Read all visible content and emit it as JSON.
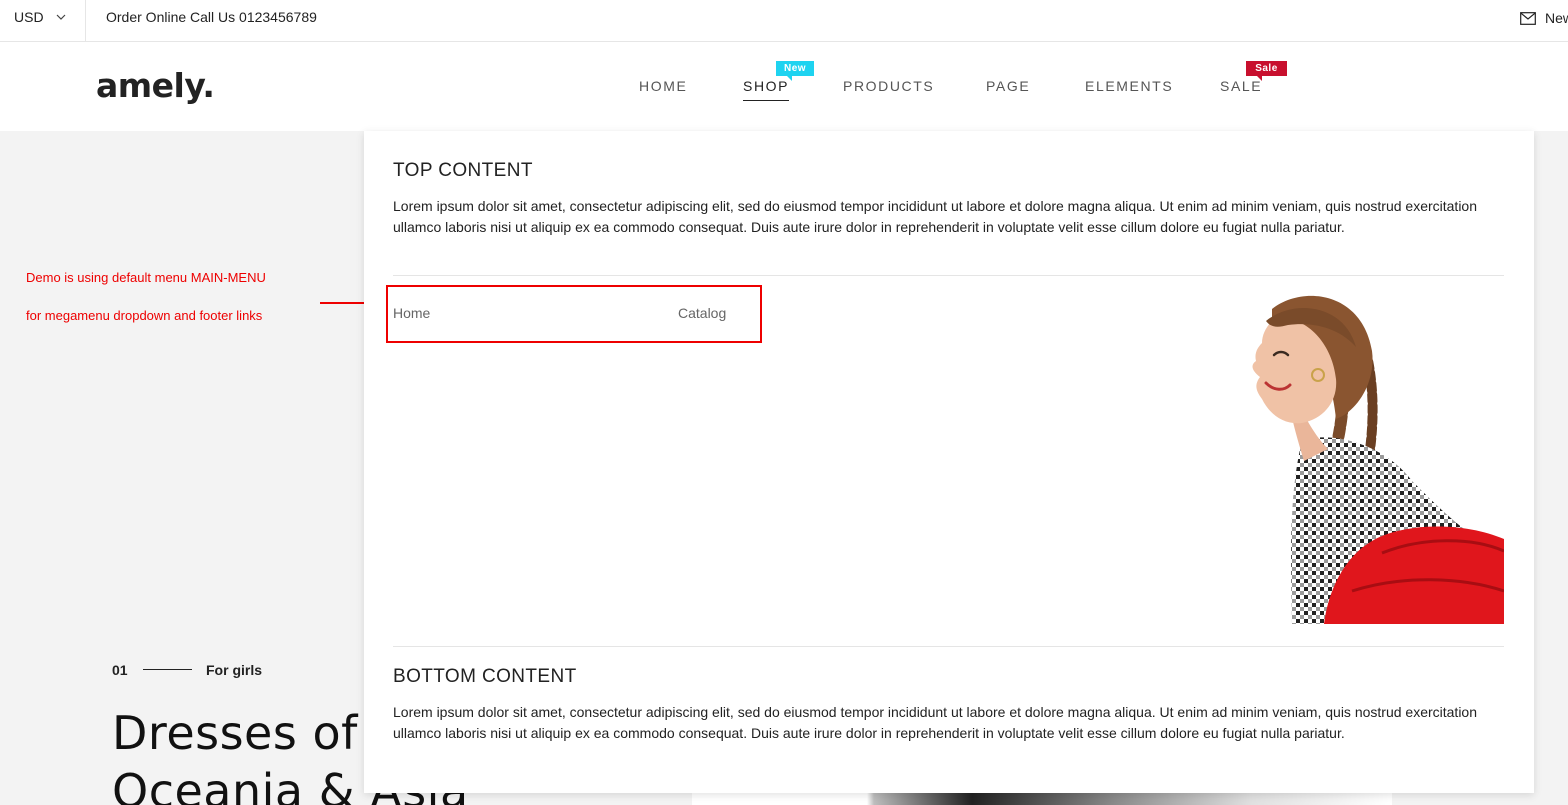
{
  "topbar": {
    "currency": "USD",
    "order_text": "Order Online Call Us 0123456789",
    "mail_text": "Newsletter"
  },
  "header": {
    "logo": "amely.",
    "nav": [
      {
        "label": "HOME"
      },
      {
        "label": "SHOP",
        "active": true,
        "badge": "New"
      },
      {
        "label": "PRODUCTS"
      },
      {
        "label": "PAGE"
      },
      {
        "label": "ELEMENTS"
      },
      {
        "label": "SALE",
        "badge": "Sale"
      }
    ]
  },
  "annotation": {
    "line1": "Demo is using default menu MAIN-MENU",
    "line2": "for megamenu dropdown and footer links"
  },
  "megamenu": {
    "top_title": "TOP CONTENT",
    "top_text": "Lorem ipsum dolor sit amet, consectetur adipiscing elit, sed do eiusmod tempor incididunt ut labore et dolore magna aliqua. Ut enim ad minim veniam, quis nostrud exercitation ullamco laboris nisi ut aliquip ex ea commodo consequat. Duis aute irure dolor in reprehenderit in voluptate velit esse cillum dolore eu fugiat nulla pariatur.",
    "links": [
      "Home",
      "Catalog"
    ],
    "bottom_title": "BOTTOM CONTENT",
    "bottom_text": "Lorem ipsum dolor sit amet, consectetur adipiscing elit, sed do eiusmod tempor incididunt ut labore et dolore magna aliqua. Ut enim ad minim veniam, quis nostrud exercitation ullamco laboris nisi ut aliquip ex ea commodo consequat. Duis aute irure dolor in reprehenderit in voluptate velit esse cillum dolore eu fugiat nulla pariatur."
  },
  "hero": {
    "number": "01",
    "category": "For girls",
    "title_line1": "Dresses of",
    "title_line2": "Oceania & Asia"
  },
  "colors": {
    "badge_new": "#1ed3f0",
    "badge_sale": "#c8102e",
    "annotation": "#ee0000"
  }
}
